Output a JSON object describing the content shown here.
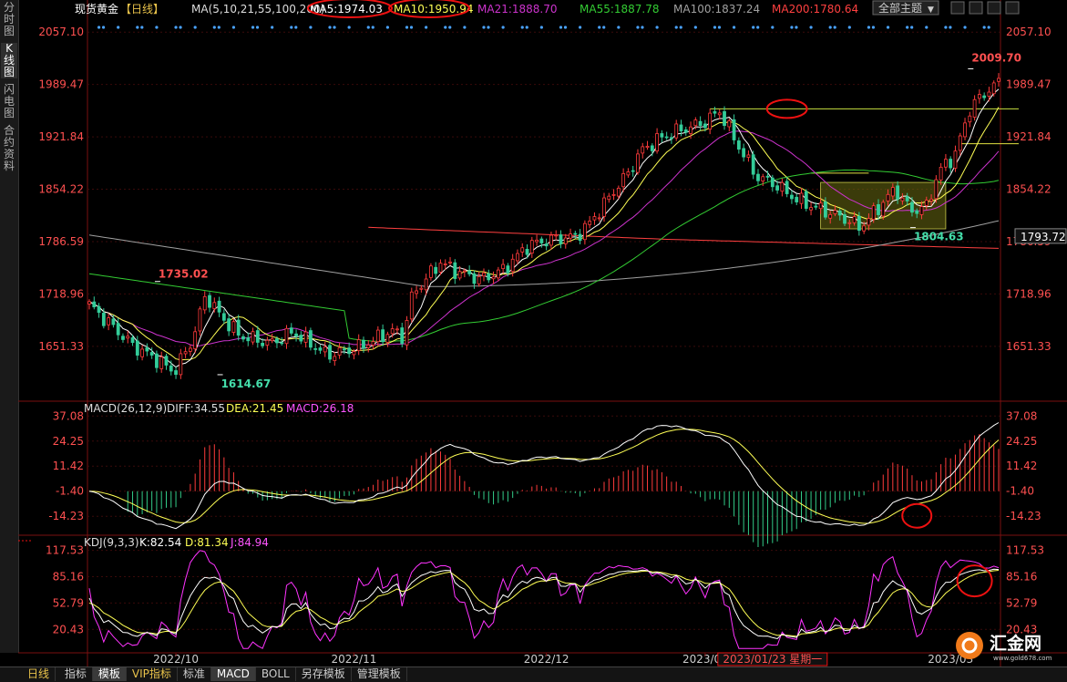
{
  "left_tabs": [
    {
      "label": "分时图",
      "active": false
    },
    {
      "label": "K线图",
      "active": true
    },
    {
      "label": "闪电图",
      "active": false
    },
    {
      "label": "合约资料",
      "active": false
    }
  ],
  "header": {
    "symbol": "现货黄金",
    "period": "【日线】",
    "ma_group": "MA(5,10,21,55,100,200)",
    "ma_values": [
      {
        "label": "MA5:1974.03",
        "color": "#ffffff"
      },
      {
        "label": "MA10:1950.94",
        "color": "#ffff55"
      },
      {
        "label": "MA21:1888.70",
        "color": "#cc33cc"
      },
      {
        "label": "MA55:1887.78",
        "color": "#33cc33"
      },
      {
        "label": "MA100:1837.24",
        "color": "#a0a0a0"
      },
      {
        "label": "MA200:1780.64",
        "color": "#ff4040"
      }
    ],
    "theme_select": "全部主题",
    "theme_arrow": "▼"
  },
  "macd_header": {
    "label": "MACD(26,12,9)",
    "diff": "DIFF:34.55",
    "dea": "DEA:21.45",
    "macd": "MACD:26.18"
  },
  "kdj_header": {
    "label": "KDJ(9,3,3)",
    "k": "K:82.54",
    "d": "D:81.34",
    "j": "J:84.94"
  },
  "colors": {
    "up": "#ff3b3b",
    "down": "#33cc99",
    "axis_text": "#ff5050",
    "grid": "#7a1010",
    "dots": "#4aa3ff"
  },
  "bottom_bar": {
    "period_label": "日线",
    "tabs": [
      {
        "label": "指标",
        "active": false,
        "vip": false
      },
      {
        "label": "模板",
        "active": true,
        "vip": false
      },
      {
        "label": "VIP指标",
        "active": false,
        "vip": true
      },
      {
        "label": "标准",
        "active": false,
        "vip": false
      },
      {
        "label": "MACD",
        "active": true,
        "vip": false
      },
      {
        "label": "BOLL",
        "active": false,
        "vip": false
      },
      {
        "label": "另存模板",
        "active": false,
        "vip": false
      },
      {
        "label": "管理模板",
        "active": false,
        "vip": false
      }
    ]
  },
  "logo": {
    "text": "汇金网",
    "site": "www.gold678.com"
  },
  "chart_data": [
    {
      "type": "candlestick",
      "title": "现货黄金 日线",
      "yticks": [
        2057.1,
        1989.47,
        1921.84,
        1854.22,
        1786.59,
        1718.96,
        1651.33
      ],
      "ylim": [
        1584.0,
        2075.0
      ],
      "x_labels": [
        "2022/10",
        "2022/11",
        "2022/12",
        "2023/01",
        "2023/03"
      ],
      "crosshair_date_label": "2023/01/23 星期一",
      "current_price_label": "1793.72",
      "annotations": [
        {
          "text": "1735.02",
          "price": 1735.02,
          "color": "#ff5050"
        },
        {
          "text": "1614.67",
          "price": 1614.67,
          "color": "#44ddaa"
        },
        {
          "text": "1804.63",
          "price": 1804.63,
          "color": "#44ddaa"
        },
        {
          "text": "2009.70",
          "price": 2009.7,
          "color": "#ff5050"
        }
      ],
      "grid": true,
      "legend": "top-left"
    },
    {
      "type": "bar",
      "title": "MACD(26,12,9)",
      "yticks": [
        37.08,
        24.25,
        11.42,
        -1.4,
        -14.23
      ],
      "ylim": [
        -23.0,
        40.0
      ],
      "series": [
        {
          "name": "DIFF",
          "last": 34.55
        },
        {
          "name": "DEA",
          "last": 21.45
        },
        {
          "name": "MACD",
          "last": 26.18
        }
      ]
    },
    {
      "type": "line",
      "title": "KDJ(9,3,3)",
      "yticks": [
        117.53,
        85.16,
        52.79,
        20.43
      ],
      "ylim": [
        -5.0,
        125.0
      ],
      "series": [
        {
          "name": "K",
          "last": 82.54
        },
        {
          "name": "D",
          "last": 81.34
        },
        {
          "name": "J",
          "last": 84.94
        }
      ]
    }
  ]
}
